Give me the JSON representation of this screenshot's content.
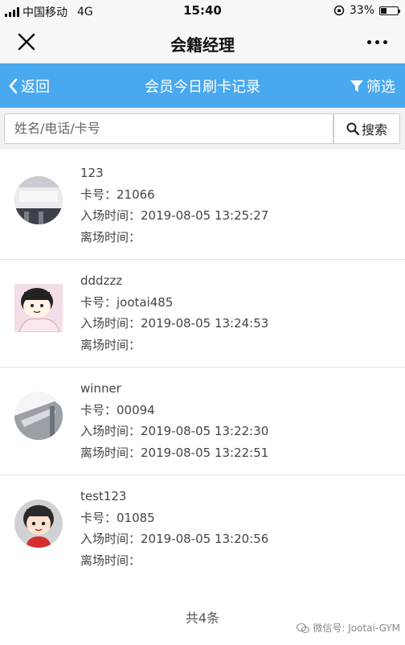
{
  "status": {
    "carrier": "中国移动",
    "network": "4G",
    "time": "15:40",
    "battery": "33%",
    "battery_level": 0.33
  },
  "wechat_bar": {
    "title": "会籍经理",
    "close_icon": "close-icon",
    "more_icon": "more-icon"
  },
  "app_bar": {
    "back_label": "返回",
    "title": "会员今日刷卡记录",
    "filter_label": "筛选",
    "accent": "#4aa8ee"
  },
  "search": {
    "placeholder": "姓名/电话/卡号",
    "button_label": "搜索"
  },
  "records": [
    {
      "name": "123",
      "card": "卡号：21066",
      "enter": "入场时间：2019-08-05 13:25:27",
      "leave": "离场时间："
    },
    {
      "name": "dddzzz",
      "card": "卡号：jootai485",
      "enter": "入场时间：2019-08-05 13:24:53",
      "leave": "离场时间："
    },
    {
      "name": "winner",
      "card": "卡号：00094",
      "enter": "入场时间：2019-08-05 13:22:30",
      "leave": "离场时间：2019-08-05 13:22:51"
    },
    {
      "name": "test123",
      "card": "卡号：01085",
      "enter": "入场时间：2019-08-05 13:20:56",
      "leave": "离场时间："
    }
  ],
  "footer": {
    "total": "共4条",
    "watermark": "微信号: Jootai-GYM"
  }
}
